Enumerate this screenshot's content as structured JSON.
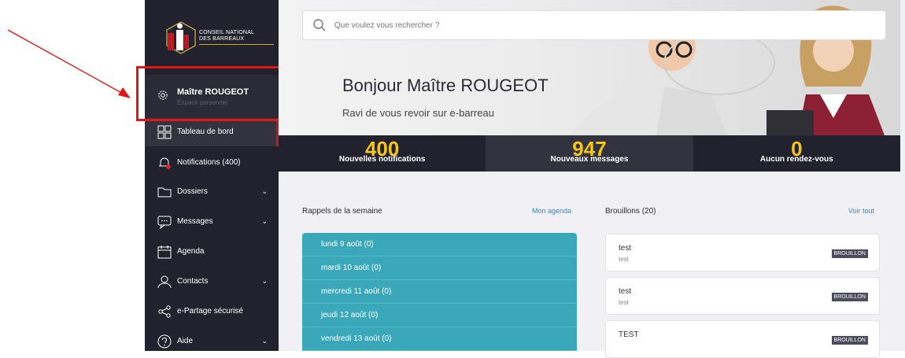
{
  "sidebar": {
    "logo_line1": "CONSEIL NATIONAL",
    "logo_line2": "DES BARREAUX",
    "profile_name": "Maître ROUGEOT",
    "profile_sub": "Espace personnel",
    "items": [
      {
        "label": "Tableau de bord",
        "icon": "dashboard-icon"
      },
      {
        "label": "Notifications (400)",
        "icon": "bell-icon"
      },
      {
        "label": "Dossiers",
        "icon": "folder-icon"
      },
      {
        "label": "Messages",
        "icon": "message-icon"
      },
      {
        "label": "Agenda",
        "icon": "calendar-icon"
      },
      {
        "label": "Contacts",
        "icon": "user-icon"
      },
      {
        "label": "e-Partage sécurisé",
        "icon": "share-icon"
      },
      {
        "label": "Aide",
        "icon": "help-icon"
      }
    ],
    "chevron": "⌄"
  },
  "search": {
    "placeholder": "Que voulez vous rechercher ?"
  },
  "hero": {
    "title": "Bonjour Maître ROUGEOT",
    "subtitle": "Ravi de vous revoir sur e-barreau"
  },
  "stats": [
    {
      "value": "400",
      "label": "Nouvelles notifications"
    },
    {
      "value": "947",
      "label": "Nouveaux messages"
    },
    {
      "value": "0",
      "label": "Aucun rendez-vous"
    }
  ],
  "reminders": {
    "title": "Rappels de la semaine",
    "link": "Mon agenda",
    "days": [
      "lundi 9 août (0)",
      "mardi 10 août (0)",
      "mercredi 11 août (0)",
      "jeudi 12 août (0)",
      "vendredi 13 août (0)"
    ]
  },
  "drafts": {
    "title": "Brouillons (20)",
    "link": "Voir tout",
    "badge": "BROUILLON",
    "items": [
      {
        "title": "test",
        "sub": "test"
      },
      {
        "title": "test",
        "sub": "test"
      },
      {
        "title": "TEST",
        "sub": ""
      }
    ]
  },
  "colors": {
    "sidebar": "#22222e",
    "accent_yellow": "#f5c518",
    "teal": "#3ba8b9",
    "link": "#3e84c4",
    "annotation_red": "#e11616"
  }
}
